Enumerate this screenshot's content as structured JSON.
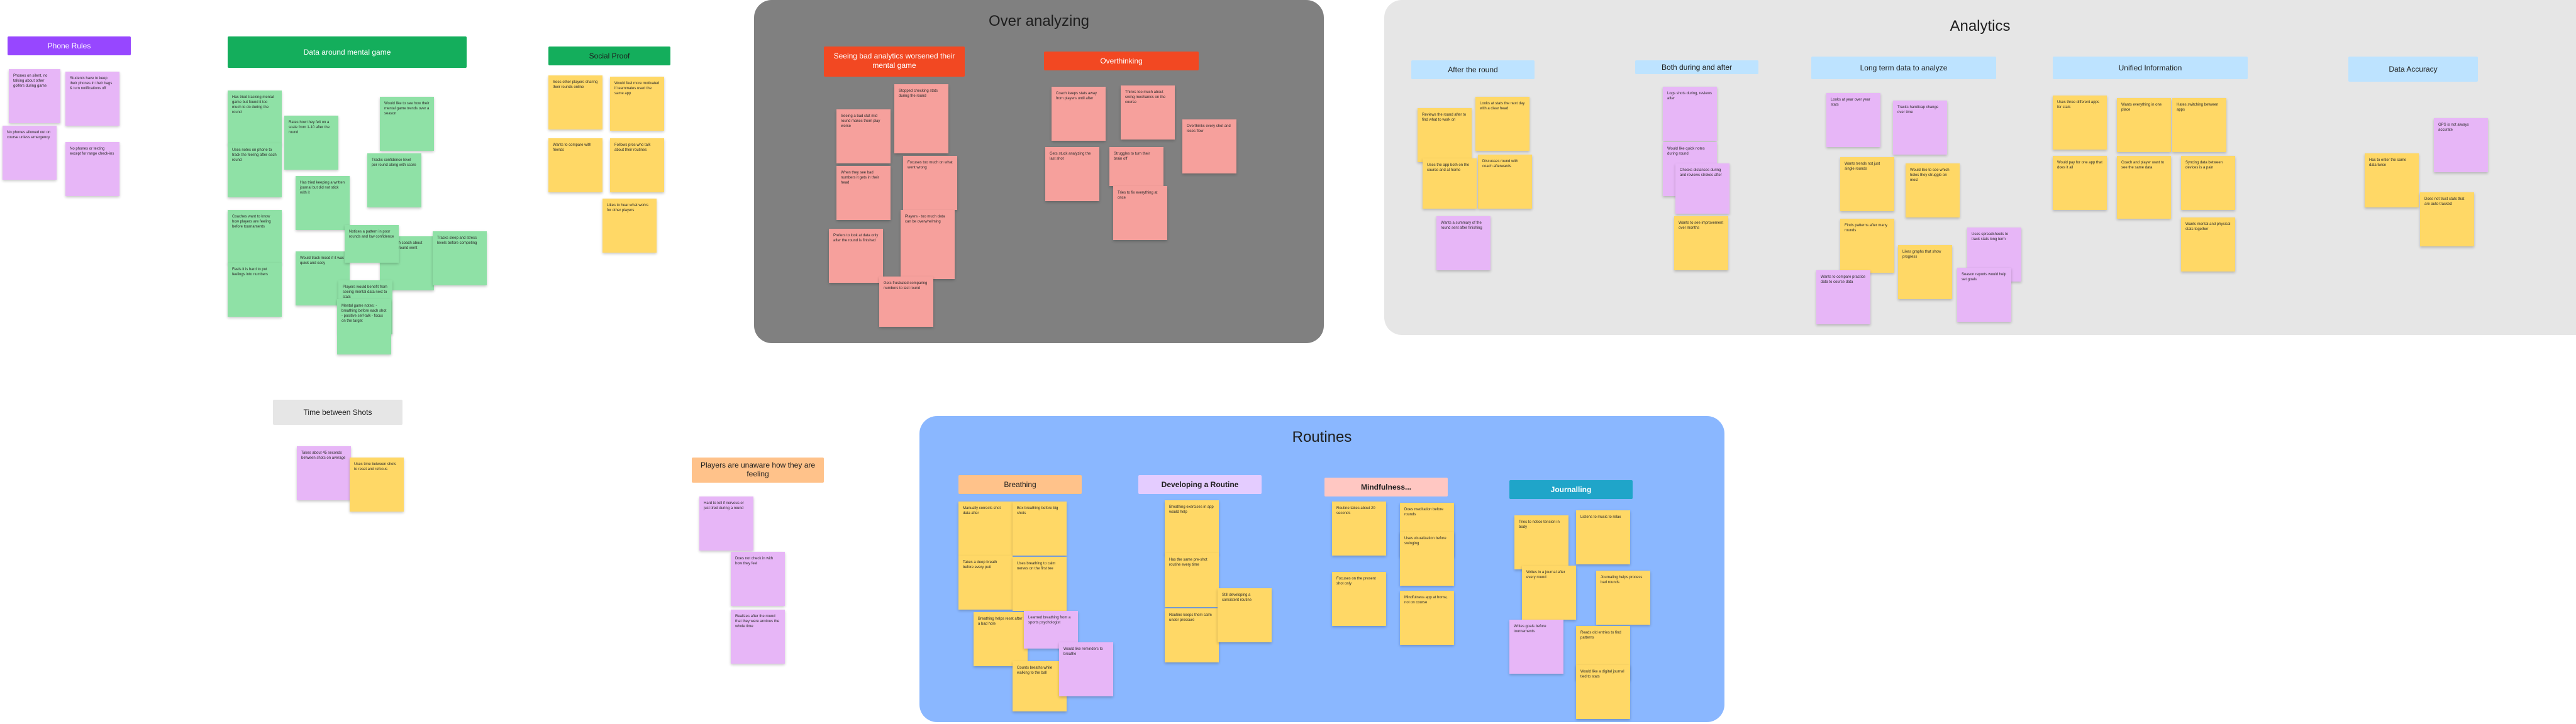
{
  "colors": {
    "over_analyzing_bg": "#808080",
    "analytics_bg": "#e6e6e6",
    "routines_bg": "#8ab7ff",
    "header_purple": "#9747ff",
    "header_green": "#14ae5c",
    "header_red": "#f24822",
    "header_lightblue": "#bde3ff",
    "header_grey": "#e6e6e6",
    "header_peach": "#ffc28a",
    "header_lavender": "#e4ccff",
    "header_pink": "#ffc7c2",
    "header_teal": "#1fa5c9",
    "sticky_yellow": "#ffd866",
    "sticky_pink": "#f6a09c",
    "sticky_green": "#8fe1a6",
    "sticky_purple": "#e7b6f7"
  },
  "sections": {
    "over_analyzing": {
      "title": "Over analyzing"
    },
    "analytics": {
      "title": "Analytics"
    },
    "routines": {
      "title": "Routines"
    }
  },
  "headers": {
    "phone_rules": "Phone Rules",
    "data_mental_game": "Data around mental game",
    "social_proof": "Social Proof",
    "time_between_shots": "Time between Shots",
    "players_unaware": "Players are unaware how they are feeling",
    "seeing_bad_analytics": "Seeing bad analytics worsened their mental game",
    "overthinking": "Overthinking",
    "after_the_round": "After the round",
    "both_during_and_after": "Both during and after",
    "long_term_data": "Long term data to analyze",
    "unified_information": "Unified Information",
    "data_accuracy": "Data Accuracy",
    "breathing": "Breathing",
    "developing_routine": "Developing a Routine",
    "mindfulness": "Mindfulness...",
    "journalling": "Journalling"
  },
  "stickies": [
    {
      "c": "purple",
      "t": "Phones on silent, no talking about other golfers during game"
    },
    {
      "c": "purple",
      "t": "Students have to keep their phones in their bags & turn notifications off"
    },
    {
      "c": "purple",
      "t": "No phones allowed out on course unless emergency"
    },
    {
      "c": "purple",
      "t": "No phones or texting except for range check-ins"
    },
    {
      "c": "green",
      "t": "Has tried tracking mental game but found it too much to do during the round"
    },
    {
      "c": "green",
      "t": "Uses notes on phone to track the feeling after each round"
    },
    {
      "c": "green",
      "t": "Rates how they felt on a scale from 1-10 after the round"
    },
    {
      "c": "green",
      "t": "Would like to see how their mental game trends over a season"
    },
    {
      "c": "green",
      "t": "Coaches want to know how players are feeling before tournaments"
    },
    {
      "c": "green",
      "t": "Tracks confidence level per round along with score"
    },
    {
      "c": "green",
      "t": "Has tried keeping a written journal but did not stick with it"
    },
    {
      "c": "green",
      "t": "Feels it is hard to put feelings into numbers"
    },
    {
      "c": "green",
      "t": "Would track mood if it was quick and easy"
    },
    {
      "c": "green",
      "t": "Talks with coach about how the round went mentally"
    },
    {
      "c": "green",
      "t": "Tracks sleep and stress levels before competing"
    },
    {
      "c": "green",
      "t": "Players would benefit from seeing mental data next to stats"
    },
    {
      "c": "green",
      "t": "Notices a pattern in poor rounds and low confidence"
    },
    {
      "c": "green",
      "t": "Mental game notes: - breathing before each shot - positive self-talk - focus on the target"
    },
    {
      "c": "yellow",
      "t": "Sees other players sharing their rounds online"
    },
    {
      "c": "yellow",
      "t": "Would feel more motivated if teammates used the same app"
    },
    {
      "c": "yellow",
      "t": "Wants to compare with friends"
    },
    {
      "c": "yellow",
      "t": "Follows pros who talk about their routines"
    },
    {
      "c": "yellow",
      "t": "Likes to hear what works for other players"
    },
    {
      "c": "purple",
      "t": "Takes about 45 seconds between shots on average"
    },
    {
      "c": "yellow",
      "t": "Uses time between shots to reset and refocus"
    },
    {
      "c": "purple",
      "t": "Hard to tell if nervous or just tired during a round"
    },
    {
      "c": "purple",
      "t": "Does not check in with how they feel"
    },
    {
      "c": "purple",
      "t": "Realizes after the round that they were anxious the whole time"
    },
    {
      "c": "pink",
      "t": "Seeing a bad stat mid round makes them play worse"
    },
    {
      "c": "pink",
      "t": "Stopped checking stats during the round"
    },
    {
      "c": "pink",
      "t": "When they see bad numbers it gets in their head"
    },
    {
      "c": "pink",
      "t": "Focuses too much on what went wrong"
    },
    {
      "c": "pink",
      "t": "Prefers to look at data only after the round is finished"
    },
    {
      "c": "pink",
      "t": "Players - too much data can be overwhelming"
    },
    {
      "c": "pink",
      "t": "Gets frustrated comparing numbers to last round"
    },
    {
      "c": "pink",
      "t": "Coach keeps stats away from players until after"
    },
    {
      "c": "pink",
      "t": "Thinks too much about swing mechanics on the course"
    },
    {
      "c": "pink",
      "t": "Overthinks every shot and loses flow"
    },
    {
      "c": "pink",
      "t": "Gets stuck analyzing the last shot"
    },
    {
      "c": "pink",
      "t": "Struggles to turn their brain off"
    },
    {
      "c": "pink",
      "t": "Tries to fix everything at once"
    },
    {
      "c": "yellow",
      "t": "Reviews the round after to find what to work on"
    },
    {
      "c": "yellow",
      "t": "Looks at stats the next day with a clear head"
    },
    {
      "c": "yellow",
      "t": "Discusses round with coach afterwards"
    },
    {
      "c": "purple",
      "t": "Wants a summary of the round sent after finishing"
    },
    {
      "c": "purple",
      "t": "Uses the app both on the course and at home"
    },
    {
      "c": "purple",
      "t": "Logs shots during, reviews after"
    },
    {
      "c": "purple",
      "t": "Would like quick notes during round"
    },
    {
      "c": "yellow",
      "t": "Checks distances during and reviews strokes after"
    },
    {
      "c": "purple",
      "t": "Wants to see improvement over months"
    },
    {
      "c": "purple",
      "t": "Looks at year over year stats"
    },
    {
      "c": "purple",
      "t": "Tracks handicap change over time"
    },
    {
      "c": "yellow",
      "t": "Wants trends not just single rounds"
    },
    {
      "c": "yellow",
      "t": "Would like to see which holes they struggle on most"
    },
    {
      "c": "yellow",
      "t": "Finds patterns after many rounds"
    },
    {
      "c": "yellow",
      "t": "Likes graphs that show progress"
    },
    {
      "c": "purple",
      "t": "Wants to compare practice data to course data"
    },
    {
      "c": "purple",
      "t": "Uses spreadsheets to track stats long term"
    },
    {
      "c": "purple",
      "t": "Season reports would help set goals"
    },
    {
      "c": "yellow",
      "t": "Uses three different apps for stats"
    },
    {
      "c": "yellow",
      "t": "Wants everything in one place"
    },
    {
      "c": "yellow",
      "t": "Hates switching between apps"
    },
    {
      "c": "yellow",
      "t": "Would pay for one app that does it all"
    },
    {
      "c": "yellow",
      "t": "Coach and player want to see the same data"
    },
    {
      "c": "yellow",
      "t": "Syncing data between devices is a pain"
    },
    {
      "c": "yellow",
      "t": "Wants mental and physical stats together"
    },
    {
      "c": "yellow",
      "t": "Has to enter the same data twice"
    },
    {
      "c": "yellow",
      "t": "GPS is not always accurate"
    },
    {
      "c": "purple",
      "t": "Does not trust stats that are auto-tracked"
    },
    {
      "c": "yellow",
      "t": "Manually corrects shot data after"
    },
    {
      "c": "yellow",
      "t": "Box breathing before big shots"
    },
    {
      "c": "yellow",
      "t": "Takes a deep breath before every putt"
    },
    {
      "c": "yellow",
      "t": "Uses breathing to calm nerves on the first tee"
    },
    {
      "c": "yellow",
      "t": "Breathing helps reset after a bad hole"
    },
    {
      "c": "yellow",
      "t": "Counts breaths while walking to the ball"
    },
    {
      "c": "yellow",
      "t": "Learned breathing from a sports psychologist"
    },
    {
      "c": "purple",
      "t": "Would like reminders to breathe"
    },
    {
      "c": "purple",
      "t": "Breathing exercises in app would help"
    },
    {
      "c": "yellow",
      "t": "Has the same pre-shot routine every time"
    },
    {
      "c": "yellow",
      "t": "Routine keeps them calm under pressure"
    },
    {
      "c": "yellow",
      "t": "Still developing a consistent routine"
    },
    {
      "c": "yellow",
      "t": "Routine takes about 20 seconds"
    },
    {
      "c": "yellow",
      "t": "Does meditation before rounds"
    },
    {
      "c": "yellow",
      "t": "Focuses on the present shot only"
    },
    {
      "c": "yellow",
      "t": "Uses visualization before swinging"
    },
    {
      "c": "yellow",
      "t": "Mindfulness app at home, not on course"
    },
    {
      "c": "yellow",
      "t": "Tries to notice tension in body"
    },
    {
      "c": "yellow",
      "t": "Listens to music to relax"
    },
    {
      "c": "yellow",
      "t": "Writes in a journal after every round"
    },
    {
      "c": "yellow",
      "t": "Journaling helps process bad rounds"
    },
    {
      "c": "yellow",
      "t": "Writes goals before tournaments"
    },
    {
      "c": "yellow",
      "t": "Reads old entries to find patterns"
    },
    {
      "c": "purple",
      "t": "Would like a digital journal tied to stats"
    },
    {
      "c": "yellow",
      "t": "Writes down three good shots each round"
    },
    {
      "c": "yellow",
      "t": "Journals feelings, not just scores"
    }
  ]
}
